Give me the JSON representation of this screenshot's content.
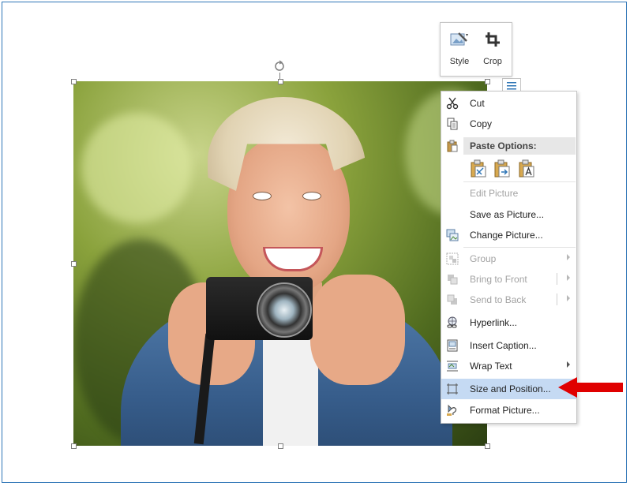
{
  "mini_toolbar": {
    "style_label": "Style",
    "crop_label": "Crop"
  },
  "context_menu": {
    "items": [
      {
        "id": "cut",
        "label": "Cut",
        "icon": "scissors-icon",
        "enabled": true
      },
      {
        "id": "copy",
        "label": "Copy",
        "icon": "copy-icon",
        "enabled": true
      },
      {
        "id": "paste_options",
        "label": "Paste Options:",
        "icon": "clipboard-icon",
        "enabled": true
      },
      {
        "id": "edit_picture",
        "label": "Edit Picture",
        "enabled": false
      },
      {
        "id": "save_as_picture",
        "label": "Save as Picture...",
        "enabled": true
      },
      {
        "id": "change_picture",
        "label": "Change Picture...",
        "icon": "change-picture-icon",
        "enabled": true
      },
      {
        "id": "group",
        "label": "Group",
        "icon": "group-icon",
        "enabled": false,
        "submenu": true
      },
      {
        "id": "bring_to_front",
        "label": "Bring to Front",
        "icon": "bring-to-front-icon",
        "enabled": false,
        "submenu": true
      },
      {
        "id": "send_to_back",
        "label": "Send to Back",
        "icon": "send-to-back-icon",
        "enabled": false,
        "submenu": true
      },
      {
        "id": "hyperlink",
        "label": "Hyperlink...",
        "icon": "hyperlink-icon",
        "enabled": true
      },
      {
        "id": "insert_caption",
        "label": "Insert Caption...",
        "icon": "caption-icon",
        "enabled": true
      },
      {
        "id": "wrap_text",
        "label": "Wrap Text",
        "icon": "wrap-text-icon",
        "enabled": true,
        "submenu": true
      },
      {
        "id": "size_and_position",
        "label": "Size and Position...",
        "icon": "size-position-icon",
        "enabled": true,
        "highlighted": true
      },
      {
        "id": "format_picture",
        "label": "Format Picture...",
        "icon": "format-picture-icon",
        "enabled": true
      }
    ],
    "paste_option_icons": [
      "paste-keep-formatting-icon",
      "paste-picture-icon",
      "paste-text-only-icon"
    ]
  },
  "colors": {
    "accent_border": "#2e75b6",
    "highlight": "#c5daf3",
    "annotation_arrow": "#e00000"
  }
}
